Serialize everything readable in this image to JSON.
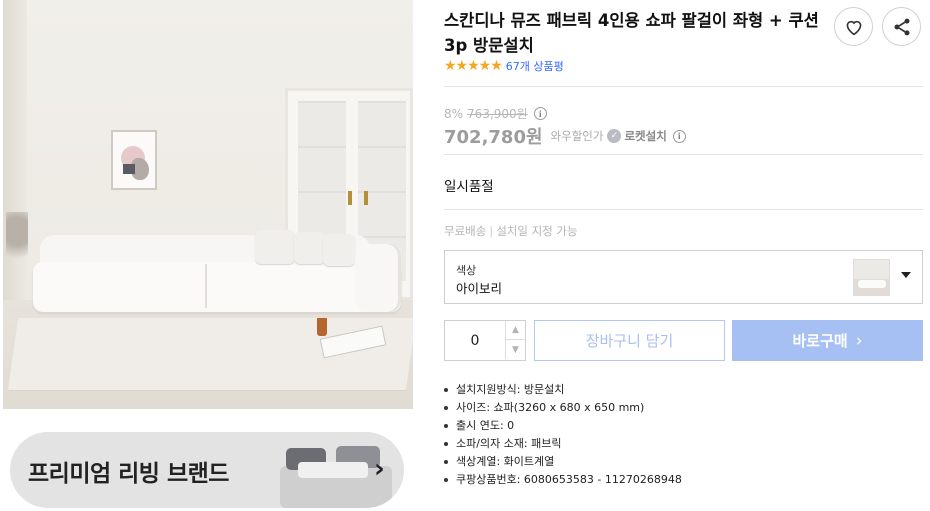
{
  "product": {
    "title": "스칸디나 뮤즈 패브릭 4인용 쇼파 팔걸이 좌형 + 쿠션 3p 방문설치",
    "stars": "★★★★★",
    "review_count": "67개 상품평",
    "discount": "8%",
    "original_price": "763,900원",
    "sale_price": "702,780원",
    "wow_text": "와우할인가",
    "rocket_label": "로켓설치",
    "status": "일시품절",
    "shipping": "무료배송",
    "shipping_sep": "|",
    "install_note": "설치일 지정 가능"
  },
  "option": {
    "label": "색상",
    "value": "아이보리"
  },
  "purchase": {
    "quantity": "0",
    "cart_label": "장바구니 담기",
    "buy_label": "바로구매",
    "buy_chevron": "›"
  },
  "specs": [
    "설치지원방식: 방문설치",
    "사이즈: 쇼파(3260 x 680 x 650 mm)",
    "출시 연도: 0",
    "소파/의자 소재: 패브릭",
    "색상계열: 화이트계열",
    "쿠팡상품번호: 6080653583 - 11270268948"
  ],
  "banner": {
    "text": "프리미엄 리빙 브랜드",
    "arrow": "›"
  },
  "icons": {
    "info": "i",
    "qty_up": "▲",
    "qty_down": "▼",
    "rocket": "✓"
  },
  "colors": {
    "accent": "#346aff",
    "star": "#f5a623",
    "buy_button": "#a7c0f4"
  }
}
